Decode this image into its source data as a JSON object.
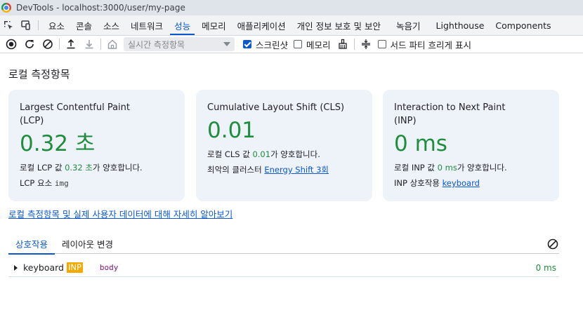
{
  "window": {
    "title": "DevTools - localhost:3000/user/my-page"
  },
  "tabs": [
    {
      "label": "요소"
    },
    {
      "label": "콘솔"
    },
    {
      "label": "소스"
    },
    {
      "label": "네트워크"
    },
    {
      "label": "성능",
      "active": true
    },
    {
      "label": "메모리"
    },
    {
      "label": "애플리케이션"
    },
    {
      "label": "개인 정보 보호 및 보안"
    },
    {
      "label": "녹음기"
    },
    {
      "label": "Lighthouse"
    },
    {
      "label": "Components"
    }
  ],
  "toolbar": {
    "throttle_placeholder": "실시간 측정항목",
    "screenshot_label": "스크린샷",
    "screenshot_checked": true,
    "memory_label": "메모리",
    "memory_checked": false,
    "third_party_label": "서드 파티 흐리게 표시",
    "third_party_checked": false
  },
  "local_metrics": {
    "title": "로컬 측정항목",
    "lcp": {
      "name": "Largest Contentful Paint (LCP)",
      "value": "0.32 초",
      "desc_prefix": "로컬 LCP 값 ",
      "desc_value": "0.32 초",
      "desc_suffix": "가 양호합니다.",
      "element_label": "LCP 요소",
      "element_value": "img"
    },
    "cls": {
      "name": "Cumulative Layout Shift (CLS)",
      "value": "0.01",
      "desc_prefix": "로컬 CLS 값 ",
      "desc_value": "0.01",
      "desc_suffix": "가 양호합니다.",
      "worst_label": "최악의 클러스터",
      "worst_link": "Energy Shift 3회"
    },
    "inp": {
      "name": "Interaction to Next Paint (INP)",
      "value": "0 ms",
      "desc_prefix": "로컬 INP 값 ",
      "desc_value": "0 ms",
      "desc_suffix": "가 양호합니다.",
      "interaction_label": "INP 상호작용",
      "interaction_link": "keyboard"
    },
    "learn_more": "로컬 측정항목 및 실제 사용자 데이터에 대해 자세히 알아보기"
  },
  "subtabs": [
    {
      "label": "상호작용",
      "active": true
    },
    {
      "label": "레이아웃 변경"
    }
  ],
  "interactions": [
    {
      "type": "keyboard",
      "badge": "INP",
      "node": "body",
      "duration": "0 ms"
    }
  ],
  "colors": {
    "accent": "#0b57d0",
    "good": "#1e8e3e",
    "card_bg": "#eef2f9",
    "inp_badge": "#f2a900"
  }
}
